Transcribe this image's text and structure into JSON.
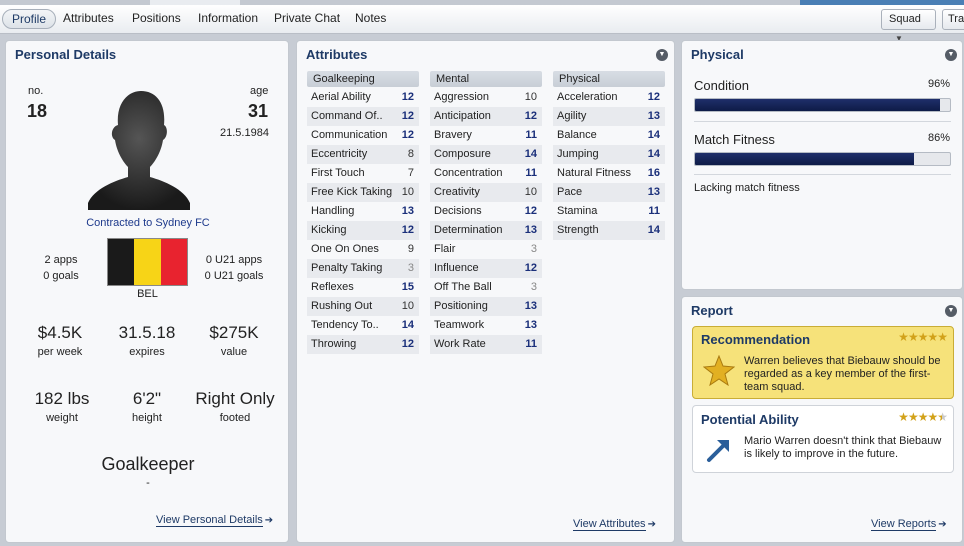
{
  "tabs": [
    "Profile",
    "Attributes",
    "Positions",
    "Information",
    "Private Chat",
    "Notes"
  ],
  "toolbar": {
    "squad_label": "Squad",
    "transfer_label": "Tran"
  },
  "personal": {
    "title": "Personal Details",
    "no_label": "no.",
    "no_value": "18",
    "age_label": "age",
    "age_value": "31",
    "dob": "21.5.1984",
    "contract": "Contracted to Sydney FC",
    "apps": "2 apps",
    "goals": "0 goals",
    "u21_apps": "0 U21 apps",
    "u21_goals": "0 U21 goals",
    "nation": "BEL",
    "flag_colors": [
      "#1a1a1a",
      "#f7d417",
      "#e8232f"
    ],
    "wage": "$4.5K",
    "wage_label": "per week",
    "expires": "31.5.18",
    "expires_label": "expires",
    "value": "$275K",
    "value_label": "value",
    "weight": "182 lbs",
    "weight_label": "weight",
    "height": "6'2\"",
    "height_label": "height",
    "foot": "Right Only",
    "foot_label": "footed",
    "position": "Goalkeeper",
    "position_sub": "-",
    "view_link": "View Personal Details"
  },
  "attributes": {
    "title": "Attributes",
    "view_link": "View Attributes",
    "columns": [
      {
        "heading": "Goalkeeping",
        "rows": [
          [
            "Aerial Ability",
            "12"
          ],
          [
            "Command Of..",
            "12"
          ],
          [
            "Communication",
            "12"
          ],
          [
            "Eccentricity",
            "8"
          ],
          [
            "First Touch",
            "7"
          ],
          [
            "Free Kick Taking",
            "10"
          ],
          [
            "Handling",
            "13"
          ],
          [
            "Kicking",
            "12"
          ],
          [
            "One On Ones",
            "9"
          ],
          [
            "Penalty Taking",
            "3"
          ],
          [
            "Reflexes",
            "15"
          ],
          [
            "Rushing Out",
            "10"
          ],
          [
            "Tendency To..",
            "14"
          ],
          [
            "Throwing",
            "12"
          ]
        ]
      },
      {
        "heading": "Mental",
        "rows": [
          [
            "Aggression",
            "10"
          ],
          [
            "Anticipation",
            "12"
          ],
          [
            "Bravery",
            "11"
          ],
          [
            "Composure",
            "14"
          ],
          [
            "Concentration",
            "11"
          ],
          [
            "Creativity",
            "10"
          ],
          [
            "Decisions",
            "12"
          ],
          [
            "Determination",
            "13"
          ],
          [
            "Flair",
            "3"
          ],
          [
            "Influence",
            "12"
          ],
          [
            "Off The Ball",
            "3"
          ],
          [
            "Positioning",
            "13"
          ],
          [
            "Teamwork",
            "13"
          ],
          [
            "Work Rate",
            "11"
          ]
        ]
      },
      {
        "heading": "Physical",
        "rows": [
          [
            "Acceleration",
            "12"
          ],
          [
            "Agility",
            "13"
          ],
          [
            "Balance",
            "14"
          ],
          [
            "Jumping",
            "14"
          ],
          [
            "Natural Fitness",
            "16"
          ],
          [
            "Pace",
            "13"
          ],
          [
            "Stamina",
            "11"
          ],
          [
            "Strength",
            "14"
          ]
        ]
      }
    ]
  },
  "physical": {
    "title": "Physical",
    "condition_label": "Condition",
    "condition_value": "96%",
    "condition_fraction": 0.96,
    "fitness_label": "Match Fitness",
    "fitness_value": "86%",
    "fitness_fraction": 0.86,
    "note": "Lacking match fitness"
  },
  "report": {
    "title": "Report",
    "rec_title": "Recommendation",
    "rec_stars": 5,
    "rec_text": "Warren believes that Biebauw should be regarded as a key member of the first-team squad.",
    "pot_title": "Potential Ability",
    "pot_stars": 4.5,
    "pot_text": "Mario Warren doesn't think that Biebauw is likely to improve in the future.",
    "view_link": "View Reports"
  },
  "colors": {
    "accent": "#1e3a66",
    "recommendation_bg": "#f6e27a",
    "fitness_bar": "#0e1b47"
  }
}
